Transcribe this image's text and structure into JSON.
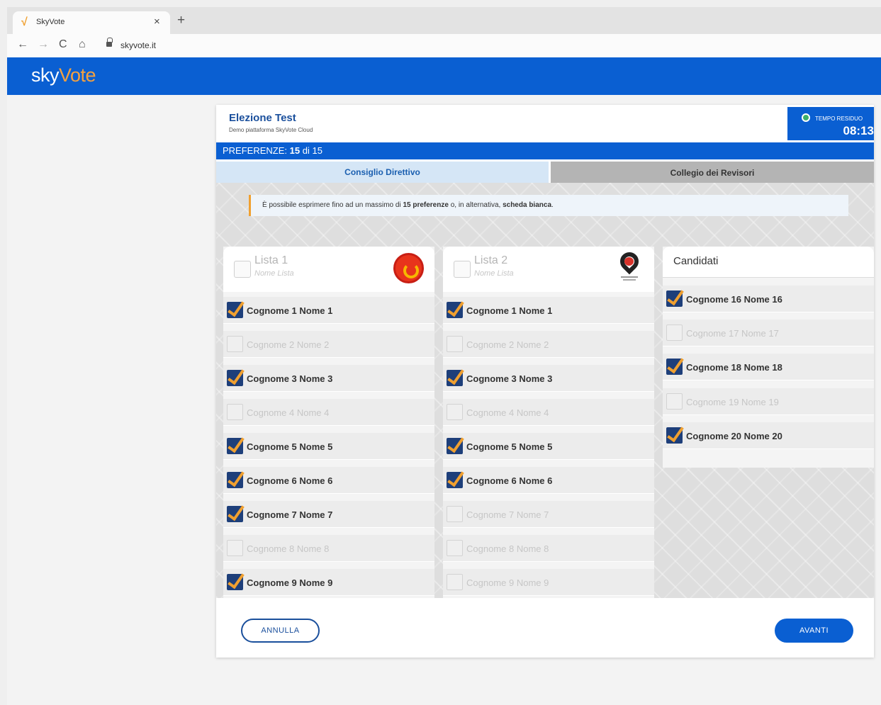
{
  "browser": {
    "tab_title": "SkyVote",
    "tab_icon": "√",
    "close": "×",
    "new_tab": "+",
    "url": "skyvote.it",
    "nav": {
      "back": "←",
      "forward": "→",
      "reload": "C",
      "home": "⌂"
    }
  },
  "app": {
    "logo_sky": "sky",
    "logo_vote": "Vote"
  },
  "election": {
    "title": "Elezione Test",
    "subtitle": "Demo piattaforma SkyVote Cloud",
    "timer_label": "TEMPO RESIDUO",
    "timer_value": "08:13",
    "pref_label": "PREFERENZE:",
    "pref_count": "15",
    "pref_of": "di 15"
  },
  "tabs": {
    "active": "Consiglio Direttivo",
    "inactive": "Collegio dei Revisori"
  },
  "info": {
    "text1": "È possibile esprimere fino ad un massimo di ",
    "bold1": "15 preferenze",
    "text2": " o, in alternativa, ",
    "bold2": "scheda bianca",
    "text3": "."
  },
  "lists": [
    {
      "name": "Lista 1",
      "subtitle": "Nome Lista",
      "logo": "red-circle-logo",
      "candidates": [
        {
          "name": "Cognome 1 Nome 1",
          "checked": true
        },
        {
          "name": "Cognome 2 Nome 2",
          "checked": false
        },
        {
          "name": "Cognome 3 Nome 3",
          "checked": true
        },
        {
          "name": "Cognome 4 Nome 4",
          "checked": false
        },
        {
          "name": "Cognome 5 Nome 5",
          "checked": true
        },
        {
          "name": "Cognome 6 Nome 6",
          "checked": true
        },
        {
          "name": "Cognome 7 Nome 7",
          "checked": true
        },
        {
          "name": "Cognome 8 Nome 8",
          "checked": false
        },
        {
          "name": "Cognome 9 Nome 9",
          "checked": true
        }
      ]
    },
    {
      "name": "Lista 2",
      "subtitle": "Nome Lista",
      "logo": "location-pin-logo",
      "candidates": [
        {
          "name": "Cognome 1 Nome 1",
          "checked": true
        },
        {
          "name": "Cognome 2 Nome 2",
          "checked": false
        },
        {
          "name": "Cognome 3 Nome 3",
          "checked": true
        },
        {
          "name": "Cognome 4 Nome 4",
          "checked": false
        },
        {
          "name": "Cognome 5 Nome 5",
          "checked": true
        },
        {
          "name": "Cognome 6 Nome 6",
          "checked": true
        },
        {
          "name": "Cognome 7 Nome 7",
          "checked": false
        },
        {
          "name": "Cognome 8 Nome 8",
          "checked": false
        },
        {
          "name": "Cognome 9 Nome 9",
          "checked": false
        }
      ]
    }
  ],
  "independent": {
    "title": "Candidati",
    "candidates": [
      {
        "name": "Cognome 16 Nome 16",
        "checked": true
      },
      {
        "name": "Cognome 17 Nome 17",
        "checked": false
      },
      {
        "name": "Cognome 18 Nome 18",
        "checked": true
      },
      {
        "name": "Cognome 19 Nome 19",
        "checked": false
      },
      {
        "name": "Cognome 20 Nome 20",
        "checked": true
      }
    ]
  },
  "buttons": {
    "cancel": "ANNULLA",
    "next": "AVANTI"
  },
  "colors": {
    "brand_blue": "#0a5fd2",
    "accent_orange": "#f0a030",
    "check_navy": "#1e3f7a"
  }
}
